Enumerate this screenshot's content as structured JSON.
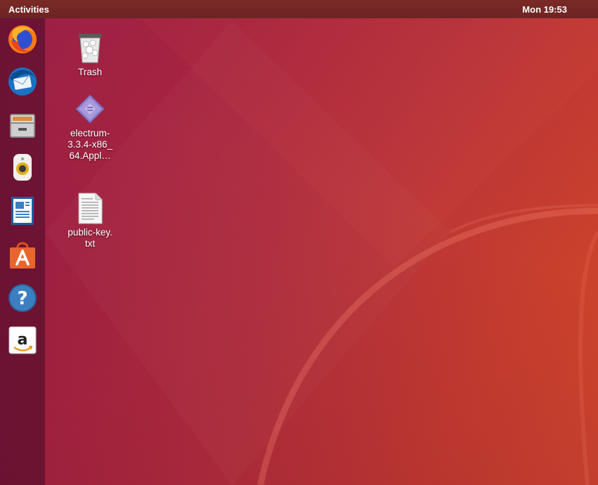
{
  "topbar": {
    "activities_label": "Activities",
    "clock": "Mon 19:53"
  },
  "dock": {
    "items": [
      {
        "name": "Firefox",
        "icon": "firefox-icon"
      },
      {
        "name": "Thunderbird",
        "icon": "thunderbird-mail-icon"
      },
      {
        "name": "Files",
        "icon": "files-cabinet-icon"
      },
      {
        "name": "Rhythmbox",
        "icon": "rhythmbox-speaker-icon"
      },
      {
        "name": "LibreOffice Writer",
        "icon": "writer-document-icon"
      },
      {
        "name": "Ubuntu Software",
        "icon": "software-bag-icon"
      },
      {
        "name": "Help",
        "icon": "help-question-icon"
      },
      {
        "name": "Amazon",
        "icon": "amazon-icon"
      }
    ]
  },
  "desktop": {
    "icons": [
      {
        "label": "Trash",
        "icon": "trash-icon"
      },
      {
        "label": "electrum-3.3.4-x86_64.Appl…",
        "line1": "electrum-",
        "line2": "3.3.4-x86_",
        "line3": "64.Appl…",
        "icon": "appimage-diamond-icon"
      },
      {
        "label": "public-key.txt",
        "line1": "public-key.",
        "line2": "txt",
        "icon": "text-file-icon"
      }
    ]
  },
  "colors": {
    "topbar": "#6e2424",
    "wallpaper_left": "#9a1f45",
    "wallpaper_right": "#d24a2a"
  }
}
